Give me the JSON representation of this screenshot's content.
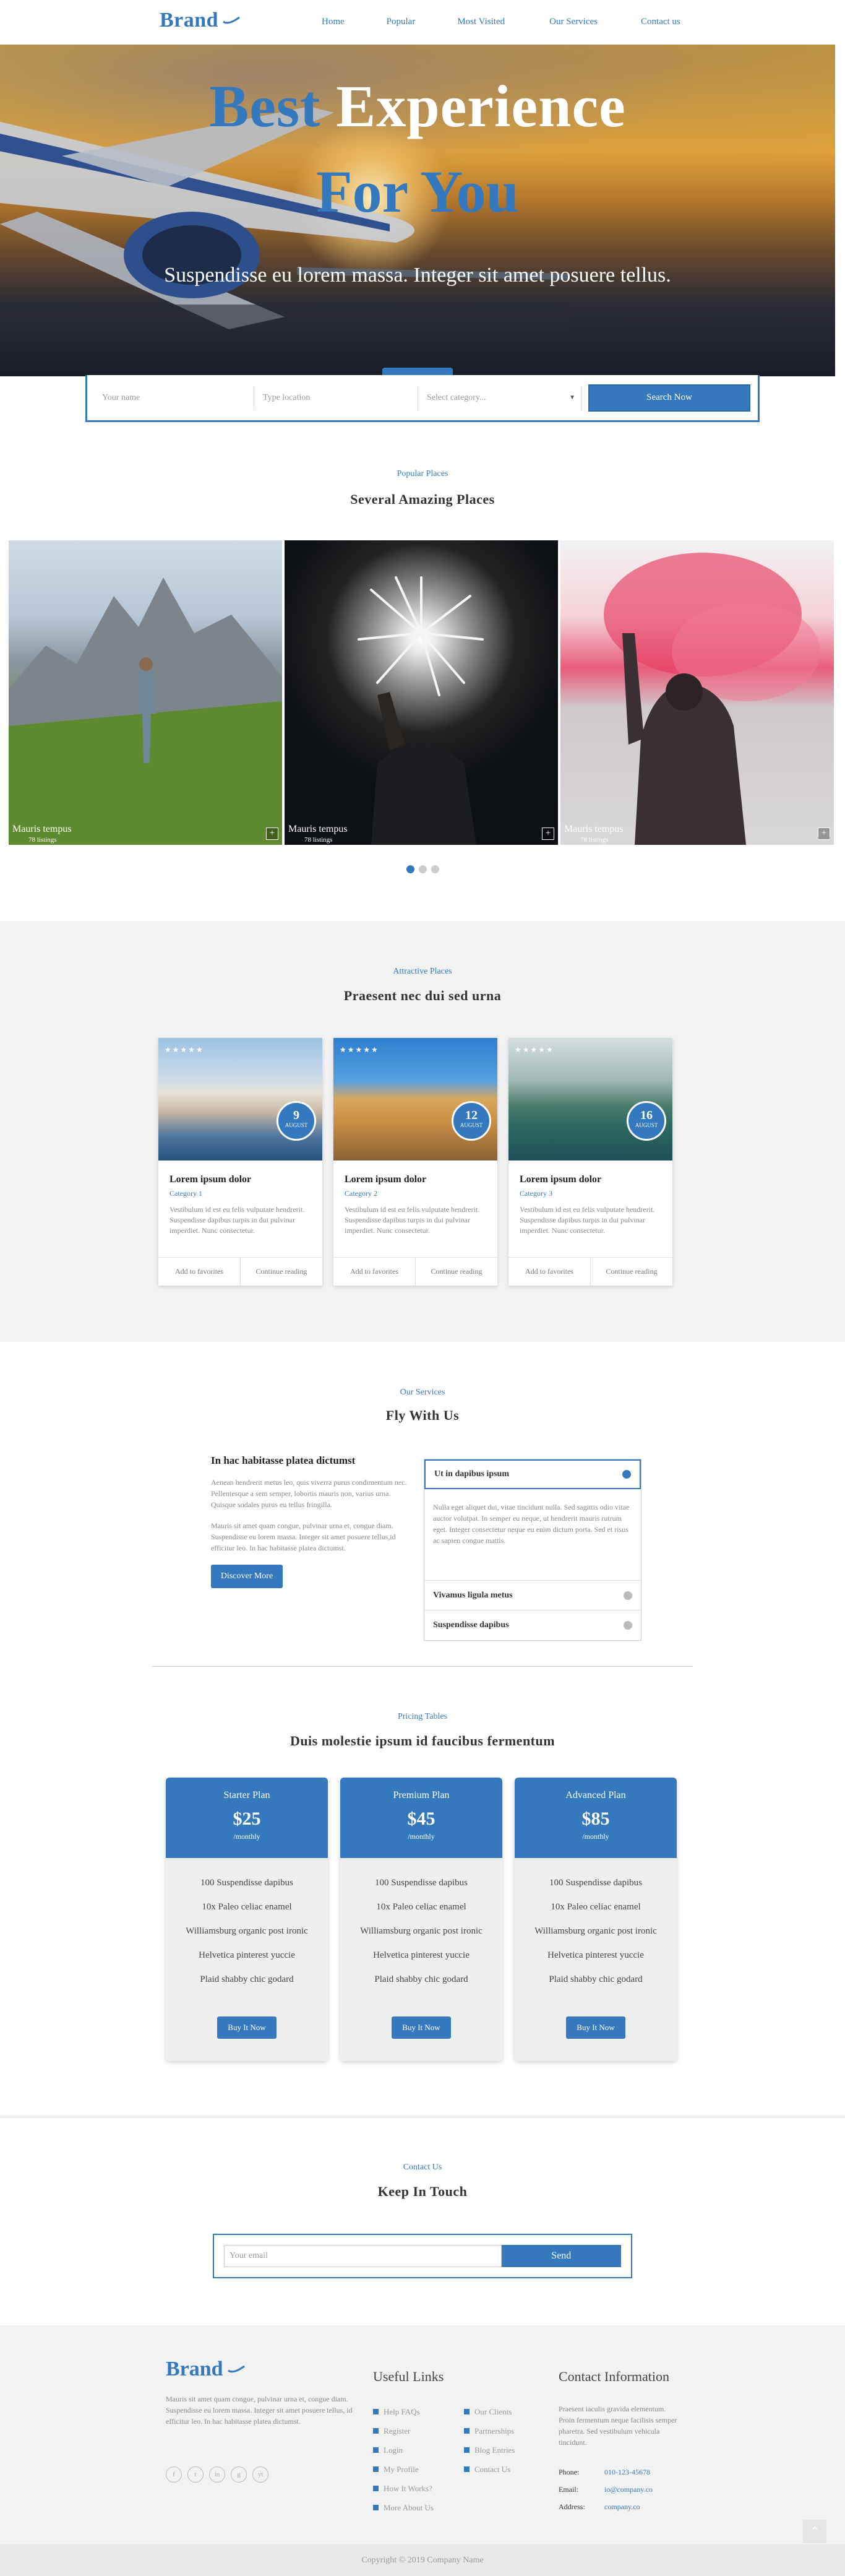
{
  "nav": {
    "brand": "Brand",
    "links": [
      "Home",
      "Popular",
      "Most Visited",
      "Our Services",
      "Contact us"
    ]
  },
  "hero": {
    "title_word1": "Best",
    "title_word2": "Experience",
    "title_line2": "For You",
    "subtitle": "Suspendisse eu lorem massa. Integer sit amet posuere tellus."
  },
  "search": {
    "name_placeholder": "Your name",
    "location_placeholder": "Type location",
    "category_placeholder": "Select category...",
    "button": "Search Now"
  },
  "popular": {
    "kicker": "Popular Places",
    "title": "Several Amazing Places",
    "slides": [
      {
        "caption": "Mauris tempus",
        "listings": "78 listings"
      },
      {
        "caption": "Mauris tempus",
        "listings": "78 listings"
      },
      {
        "caption": "Mauris tempus",
        "listings": "78 listings"
      }
    ],
    "active_dot": 1,
    "dot_count": 3
  },
  "attractive": {
    "kicker": "Attractive Places",
    "title": "Praesent nec dui sed urna",
    "cards": [
      {
        "day": "9",
        "month": "AUGUST",
        "title": "Lorem ipsum dolor",
        "category": "Category 1",
        "text": "Vestibulum id est eu felis vulputate hendrerit. Suspendisse dapibus turpis in dui pulvinar imperdiet. Nunc consectetur.",
        "fav": "Add to favorites",
        "more": "Continue reading"
      },
      {
        "day": "12",
        "month": "AUGUST",
        "title": "Lorem ipsum dolor",
        "category": "Category 2",
        "text": "Vestibulum id est eu felis vulputate hendrerit. Suspendisse dapibus turpis in dui pulvinar imperdiet. Nunc consectetur.",
        "fav": "Add to favorites",
        "more": "Continue reading"
      },
      {
        "day": "16",
        "month": "AUGUST",
        "title": "Lorem ipsum dolor",
        "category": "Category 3",
        "text": "Vestibulum id est eu felis vulputate hendrerit. Suspendisse dapibus turpis in dui pulvinar imperdiet. Nunc consectetur.",
        "fav": "Add to favorites",
        "more": "Continue reading"
      }
    ],
    "stars": "★★★★★"
  },
  "services": {
    "kicker": "Our Services",
    "title": "Fly With Us",
    "heading": "In hac habitasse platea dictumst",
    "para1": "Aenean hendrerit metus leo, quis viverra purus condimentum nec. Pellentesque a sem semper, lobortis mauris non, varius urna. Quisque sodales purus eu tellus fringilla.",
    "para2": "Mauris sit amet quam congue, pulvinar urna et, congue diam. Suspendisse eu lorem massa. Integer sit amet posuere tellus,id efficitur leo. In hac habitasse platea dictumst.",
    "button": "Discover More",
    "accordion": [
      {
        "label": "Ut in dapibus ipsum",
        "open": true,
        "text": "Nulla eget aliquet dui, vitae tincidunt nulla. Sed sagittis odio vitae auctor volutpat. In semper eu neque, ut hendrerit mauris rutrum eget. Integer consectetur neque eu enim dictum porta. Sed et risus ac sapien congue mattis."
      },
      {
        "label": "Vivamus ligula metus",
        "open": false
      },
      {
        "label": "Suspendisse dapibus",
        "open": false
      }
    ]
  },
  "pricing": {
    "kicker": "Pricing Tables",
    "title": "Duis molestie ipsum id faucibus fermentum",
    "plans": [
      {
        "name": "Starter Plan",
        "price": "$25",
        "period": "/monthly",
        "features": [
          "100 Suspendisse dapibus",
          "10x Paleo celiac enamel",
          "Williamsburg organic post ironic",
          "Helvetica pinterest yuccie",
          "Plaid shabby chic godard"
        ],
        "button": "Buy It Now"
      },
      {
        "name": "Premium Plan",
        "price": "$45",
        "period": "/monthly",
        "features": [
          "100 Suspendisse dapibus",
          "10x Paleo celiac enamel",
          "Williamsburg organic post ironic",
          "Helvetica pinterest yuccie",
          "Plaid shabby chic godard"
        ],
        "button": "Buy It Now"
      },
      {
        "name": "Advanced Plan",
        "price": "$85",
        "period": "/monthly",
        "features": [
          "100 Suspendisse dapibus",
          "10x Paleo celiac enamel",
          "Williamsburg organic post ironic",
          "Helvetica pinterest yuccie",
          "Plaid shabby chic godard"
        ],
        "button": "Buy It Now"
      }
    ]
  },
  "contact": {
    "kicker": "Contact Us",
    "title": "Keep In Touch",
    "email_placeholder": "Your email",
    "button": "Send"
  },
  "footer": {
    "brand": "Brand",
    "about": "Mauris sit amet quam congue, pulvinar urna et, congue diam. Suspendisse eu lorem massa. Integer sit amet posuere tellus, id efficitur leo. In hac habitasse platea dictumst.",
    "social_icons": [
      "f",
      "t",
      "in",
      "g",
      "yt"
    ],
    "links_title": "Useful Links",
    "links_col1": [
      "Help FAQs",
      "Register",
      "Login",
      "My Profile",
      "How It Works?",
      "More About Us"
    ],
    "links_col2": [
      "Our Clients",
      "Partnerships",
      "Blog Entries",
      "Contact Us"
    ],
    "info_title": "Contact Information",
    "info_text": "Praesent iaculis gravida elementum. Proin fermentum neque facilisis semper pharetra. Sed vestibulum vehicula tincidunt.",
    "phone_label": "Phone:",
    "phone": "010-123-45678",
    "email_label": "Email:",
    "email": "io@company.co",
    "address_label": "Address:",
    "address": "company.co",
    "to_top": "⌃"
  },
  "copyright": "Copyright © 2019 Company Name",
  "colors": {
    "accent": "#3479bd",
    "section_bg": "#f2f2f2"
  }
}
